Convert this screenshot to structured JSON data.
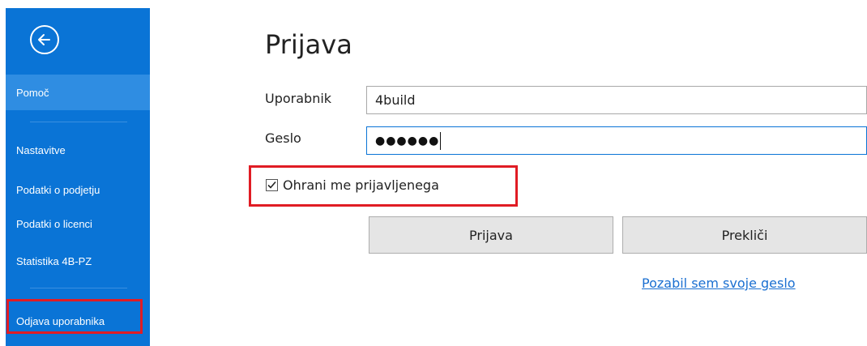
{
  "sidebar": {
    "back_icon": "arrow-left-circle-icon",
    "items": [
      {
        "label": "Pomoč",
        "selected": true
      },
      {
        "label": "Nastavitve"
      },
      {
        "label": "Podatki o podjetju"
      },
      {
        "label": "Podatki o licenci"
      },
      {
        "label": "Statistika 4B-PZ"
      },
      {
        "label": "Odjava uporabnika",
        "highlighted": true
      }
    ]
  },
  "login": {
    "title": "Prijava",
    "username_label": "Uporabnik",
    "username_value": "4build",
    "password_label": "Geslo",
    "password_value": "●●●●●●",
    "remember_label": "Ohrani me prijavljenega",
    "remember_checked": true,
    "login_button": "Prijava",
    "cancel_button": "Prekliči",
    "forgot_link": "Pozabil sem svoje geslo"
  },
  "colors": {
    "sidebar_bg": "#0a74d6",
    "sidebar_selected": "#2f8de2",
    "highlight_border": "#e01c24",
    "link": "#1a6fd1"
  }
}
